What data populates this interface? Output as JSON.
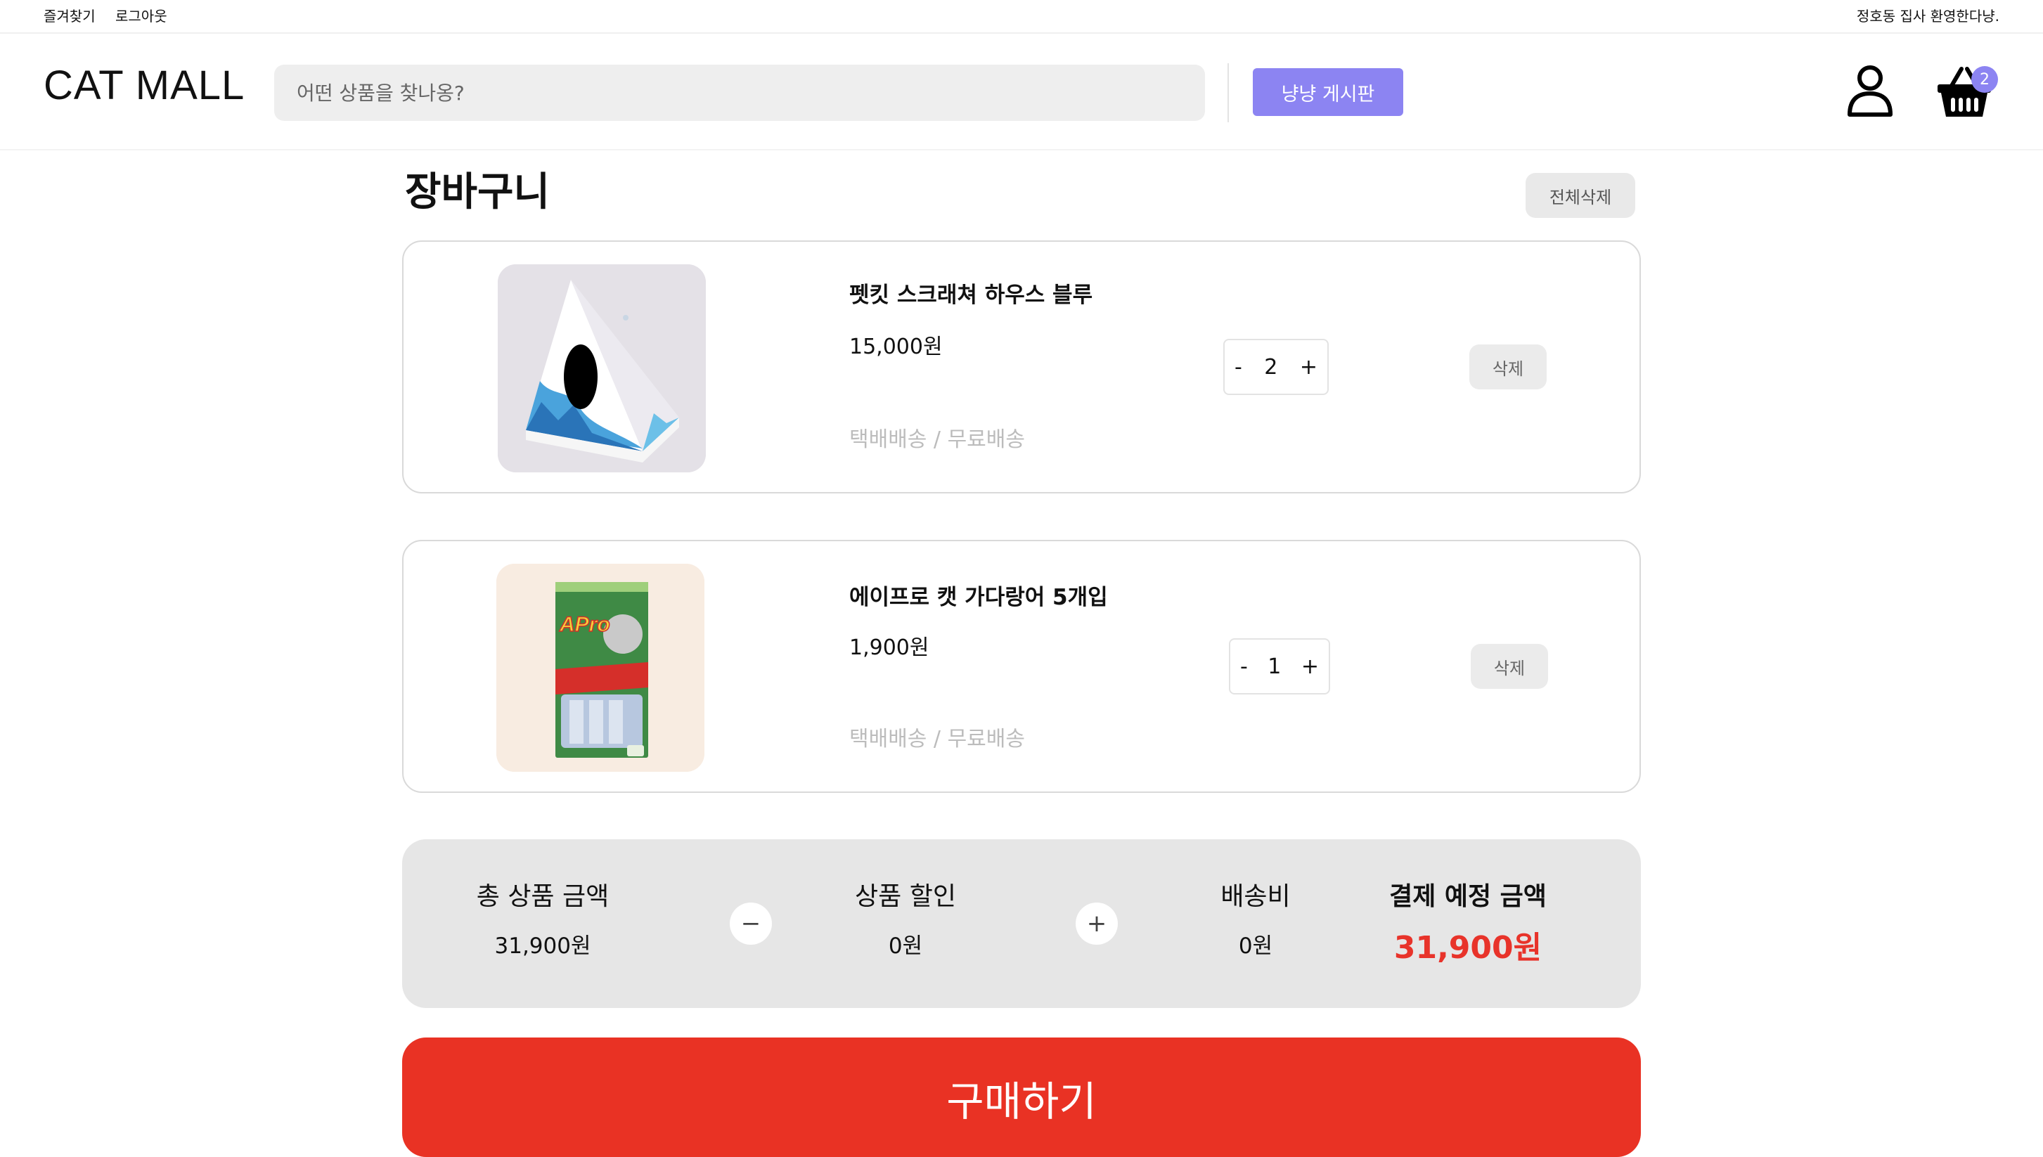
{
  "topbar": {
    "bookmark": "즐겨찾기",
    "logout": "로그아웃",
    "welcome": "정호동 집사 환영한다냥."
  },
  "header": {
    "logo": "CAT MALL",
    "search_placeholder": "어떤 상품을 찾나옹?",
    "board_button": "냥냥 게시판",
    "cart_count": "2",
    "icons": {
      "user": "user-icon",
      "cart": "basket-icon"
    },
    "accent_color": "#8c84f2"
  },
  "cart": {
    "title": "장바구니",
    "clear_all": "전체삭제",
    "items": [
      {
        "name": "펫킷 스크래쳐 하우스 블루",
        "price": "15,000원",
        "shipping": "택배배송 / 무료배송",
        "quantity": "2",
        "minus": "-",
        "plus": "+",
        "delete": "삭제"
      },
      {
        "name": "에이프로 캣 가다랑어 5개입",
        "price": "1,900원",
        "shipping": "택배배송 / 무료배송",
        "quantity": "1",
        "minus": "-",
        "plus": "+",
        "delete": "삭제",
        "package_text": "APro"
      }
    ]
  },
  "summary": {
    "total_label": "총 상품 금액",
    "total_value": "31,900원",
    "minus_sign": "−",
    "discount_label": "상품 할인",
    "discount_value": "0원",
    "plus_sign": "+",
    "shipping_label": "배송비",
    "shipping_value": "0원",
    "payment_label": "결제 예정 금액",
    "payment_value": "31,900원",
    "payment_color": "#e8332a"
  },
  "buy_button": "구매하기"
}
